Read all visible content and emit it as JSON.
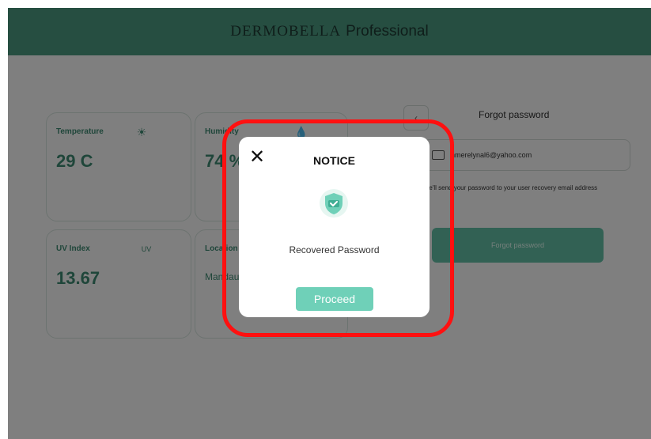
{
  "header": {
    "brand_main": "DERMOBELLA",
    "brand_sub": "Professional"
  },
  "cards": {
    "temperature": {
      "label": "Temperature",
      "value": "29 C"
    },
    "humidity": {
      "label": "Humidity",
      "value": "74 %"
    },
    "uv": {
      "label": "UV Index",
      "value": "13.67",
      "icon_text": "UV"
    },
    "location": {
      "label": "Location",
      "value": "Mandaue"
    }
  },
  "forgot": {
    "title": "Forgot password",
    "email": "hmerelynal6@yahoo.com",
    "note": "We'll send your password to your user recovery email address",
    "button": "Forgot password"
  },
  "modal": {
    "title": "NOTICE",
    "message": "Recovered Password",
    "proceed": "Proceed"
  },
  "colors": {
    "brand_green": "#4c9c82",
    "accent": "#6fd0b8",
    "highlight": "#ff1010"
  }
}
